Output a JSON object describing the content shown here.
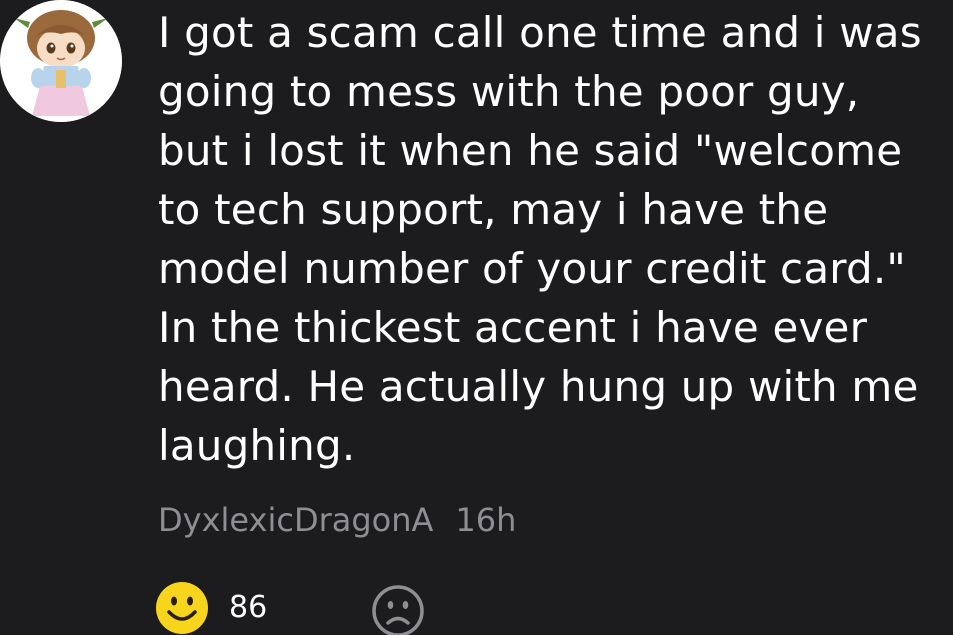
{
  "comment": {
    "lines": [
      "I got a scam call one time and i was",
      "going to mess with the poor guy,",
      "but i lost it when he said \"welcome",
      "to tech support, may i have the",
      "model number of your credit card.\"",
      "In the thickest accent i have ever",
      "heard. He actually hung up with me",
      "laughing."
    ],
    "author": "DyxlexicDragonA",
    "time": "16h"
  },
  "reactions": {
    "like_count": "86",
    "like_icon": "smiley-face-icon",
    "dislike_icon": "frowny-face-icon"
  },
  "colors": {
    "background": "#1c1c1e",
    "text": "#ffffff",
    "meta": "#8e8e93",
    "like_yellow": "#f7d51c"
  }
}
